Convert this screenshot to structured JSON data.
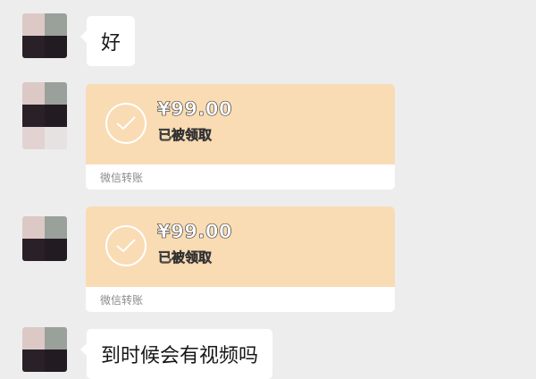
{
  "messages": [
    {
      "type": "text",
      "text": "好"
    },
    {
      "type": "transfer",
      "amount": "¥99.00",
      "status": "已被领取",
      "label": "微信转账"
    },
    {
      "type": "transfer",
      "amount": "¥99.00",
      "status": "已被领取",
      "label": "微信转账"
    },
    {
      "type": "text",
      "text": "到时候会有视频吗"
    }
  ],
  "colors": {
    "background": "#ededed",
    "bubble": "#ffffff",
    "transfer_accepted": "#f9dbb4"
  }
}
